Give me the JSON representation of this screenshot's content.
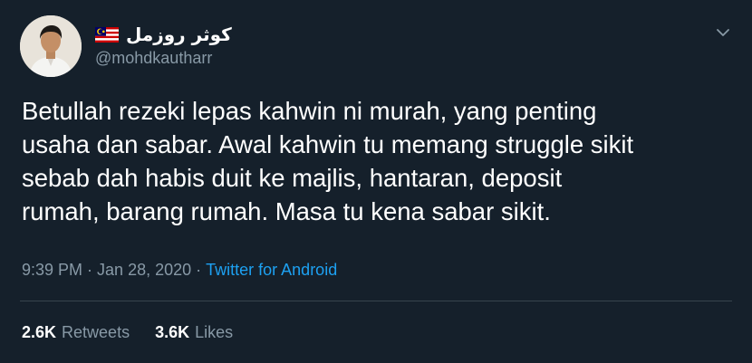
{
  "author": {
    "display_name": "كوثر روزمل",
    "handle": "@mohdkautharr",
    "flag_icon": "malaysia-flag-icon"
  },
  "tweet": {
    "text": "Betullah rezeki lepas kahwin ni murah, yang penting\nusaha dan sabar. Awal kahwin tu memang struggle sikit\nsebab dah habis duit ke majlis, hantaran, deposit\nrumah, barang rumah. Masa tu kena sabar sikit.",
    "time": "9:39 PM",
    "separator1": " · ",
    "date": "Jan 28, 2020",
    "separator2": " · ",
    "source": "Twitter for Android"
  },
  "stats": {
    "retweets_count": "2.6K",
    "retweets_label": "Retweets",
    "likes_count": "3.6K",
    "likes_label": "Likes"
  },
  "colors": {
    "background": "#15202b",
    "secondary_text": "#8899a6",
    "link": "#1da1f2",
    "divider": "#38444d"
  }
}
